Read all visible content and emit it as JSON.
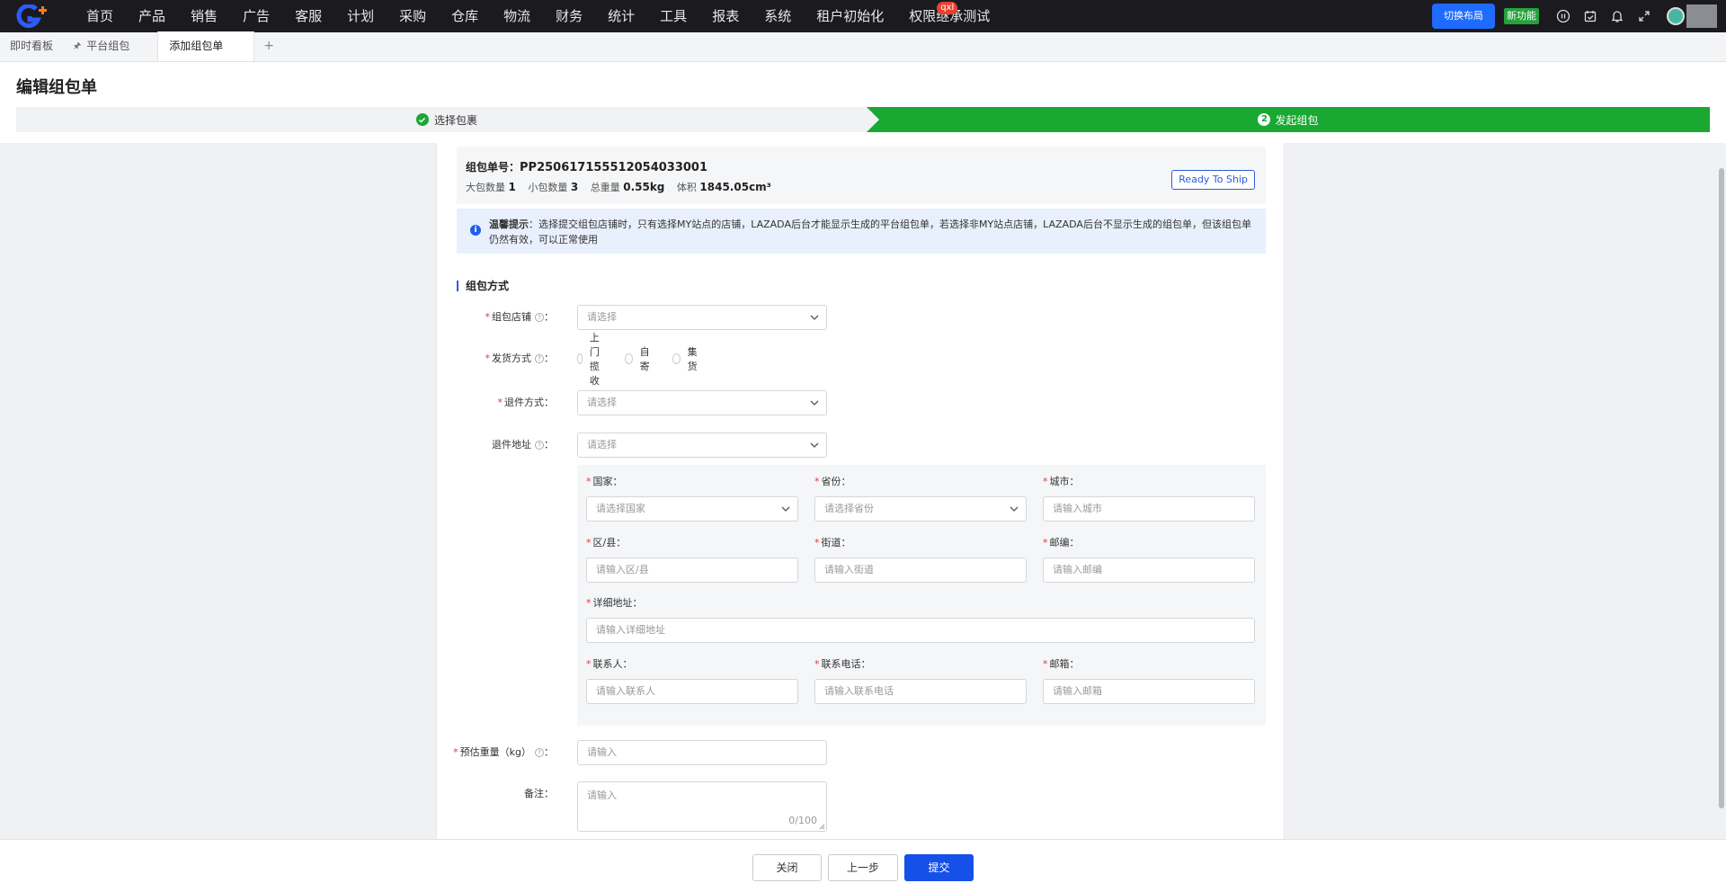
{
  "nav": {
    "items": [
      "首页",
      "产品",
      "销售",
      "广告",
      "客服",
      "计划",
      "采购",
      "仓库",
      "物流",
      "财务",
      "统计",
      "工具",
      "报表",
      "系统",
      "租户初始化",
      "权限继承测试"
    ],
    "badge": "qxl",
    "switch_layout": "切换布局",
    "new_feature": "新功能",
    "icons": [
      "pause-icon",
      "calendar-check-icon",
      "bell-icon",
      "fullscreen-icon"
    ]
  },
  "tabs": {
    "items": [
      "即时看板",
      "平台组包",
      "添加组包单"
    ],
    "add": "+"
  },
  "page": {
    "title": "编辑组包单",
    "step1": "选择包裹",
    "step2_num": "2",
    "step2": "发起组包"
  },
  "info": {
    "order_label": "组包单号：",
    "order_no": "PP250617155512054033001",
    "big_label": "大包数量",
    "big_value": "1",
    "small_label": "小包数量",
    "small_value": "3",
    "weight_label": "总重量",
    "weight_value": "0.55kg",
    "volume_label": "体积",
    "volume_value": "1845.05cm³",
    "status_button": "Ready To Ship"
  },
  "notice": {
    "bold": "温馨提示",
    "text": "：选择提交组包店铺时，只有选择MY站点的店铺，LAZADA后台才能显示生成的平台组包单，若选择非MY站点店铺，LAZADA后台不显示生成的组包单，但该组包单仍然有效，可以正常使用"
  },
  "form": {
    "section_title": "组包方式",
    "shop_label": "组包店铺",
    "shop_placeholder": "请选择",
    "ship_label": "发货方式",
    "ship_options": [
      "上门揽收",
      "自寄",
      "集货"
    ],
    "return_label": "退件方式：",
    "return_placeholder": "请选择",
    "return_addr_label": "退件地址",
    "return_addr_placeholder": "请选择",
    "weight_label": "预估重量（kg）",
    "weight_placeholder": "请输入",
    "remark_label": "备注：",
    "remark_placeholder": "请输入",
    "remark_count": "0/100",
    "colon": "："
  },
  "address": {
    "country_label": "国家：",
    "country_placeholder": "请选择国家",
    "province_label": "省份：",
    "province_placeholder": "请选择省份",
    "city_label": "城市：",
    "city_placeholder": "请输入城市",
    "district_label": "区/县：",
    "district_placeholder": "请输入区/县",
    "street_label": "街道：",
    "street_placeholder": "请输入街道",
    "zip_label": "邮编：",
    "zip_placeholder": "请输入邮编",
    "detail_label": "详细地址：",
    "detail_placeholder": "请输入详细地址",
    "contact_label": "联系人：",
    "contact_placeholder": "请输入联系人",
    "phone_label": "联系电话：",
    "phone_placeholder": "请输入联系电话",
    "email_label": "邮箱：",
    "email_placeholder": "请输入邮箱"
  },
  "footer": {
    "close": "关闭",
    "prev": "上一步",
    "submit": "提交"
  },
  "colors": {
    "accent": "#1550e8",
    "step_active": "#19a832",
    "required": "#e53935",
    "nav_bg": "#1b1b1f"
  }
}
